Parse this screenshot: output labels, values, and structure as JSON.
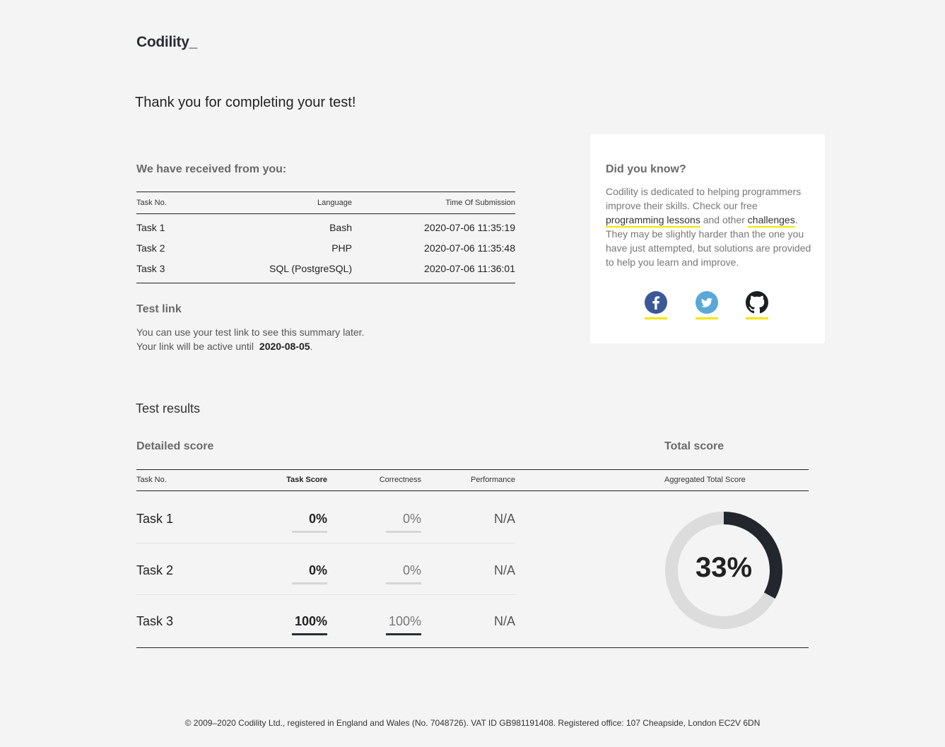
{
  "brand": {
    "logo": "Codility_"
  },
  "page_title": "Thank you for completing your test!",
  "received": {
    "heading": "We have received from you:",
    "columns": {
      "task": "Task No.",
      "language": "Language",
      "time": "Time Of Submission"
    },
    "rows": [
      {
        "task": "Task 1",
        "language": "Bash",
        "time": "2020-07-06 11:35:19"
      },
      {
        "task": "Task 2",
        "language": "PHP",
        "time": "2020-07-06 11:35:48"
      },
      {
        "task": "Task 3",
        "language": "SQL (PostgreSQL)",
        "time": "2020-07-06 11:36:01"
      }
    ]
  },
  "test_link": {
    "heading": "Test link",
    "line1": "You can use your test link to see this summary later.",
    "line2_prefix": "Your link will be active until",
    "active_until": "2020-08-05",
    "line2_suffix": "."
  },
  "did_you_know": {
    "heading": "Did you know?",
    "text_1": "Codility is dedicated to helping programmers improve their skills. Check our free ",
    "link_lessons": "programming lessons",
    "text_2": " and other ",
    "link_challenges": "challenges",
    "text_3": ". They may be slightly harder than the one you have just attempted, but solutions are provided to help you learn and improve.",
    "social": [
      {
        "name": "facebook",
        "color": "#3b5998"
      },
      {
        "name": "twitter",
        "color": "#5aa7d8"
      },
      {
        "name": "github",
        "color": "#1b1f23"
      }
    ],
    "accent_color": "#f5e400"
  },
  "results": {
    "title": "Test results",
    "detailed_heading": "Detailed score",
    "total_heading": "Total score",
    "columns": {
      "task": "Task No.",
      "score": "Task Score",
      "correctness": "Correctness",
      "performance": "Performance",
      "aggregated": "Aggregated Total Score"
    },
    "rows": [
      {
        "task": "Task 1",
        "score": "0%",
        "score_value": 0,
        "correctness": "0%",
        "correctness_value": 0,
        "performance": "N/A"
      },
      {
        "task": "Task 2",
        "score": "0%",
        "score_value": 0,
        "correctness": "0%",
        "correctness_value": 0,
        "performance": "N/A"
      },
      {
        "task": "Task 3",
        "score": "100%",
        "score_value": 100,
        "correctness": "100%",
        "correctness_value": 100,
        "performance": "N/A"
      }
    ],
    "total_score": "33%",
    "total_score_value": 33,
    "donut_colors": {
      "fill": "#23262d",
      "track": "#dcdcdc"
    }
  },
  "footer": "© 2009–2020 Codility Ltd., registered in England and Wales (No. 7048726). VAT ID GB981191408. Registered office: 107 Cheapside, London EC2V 6DN"
}
